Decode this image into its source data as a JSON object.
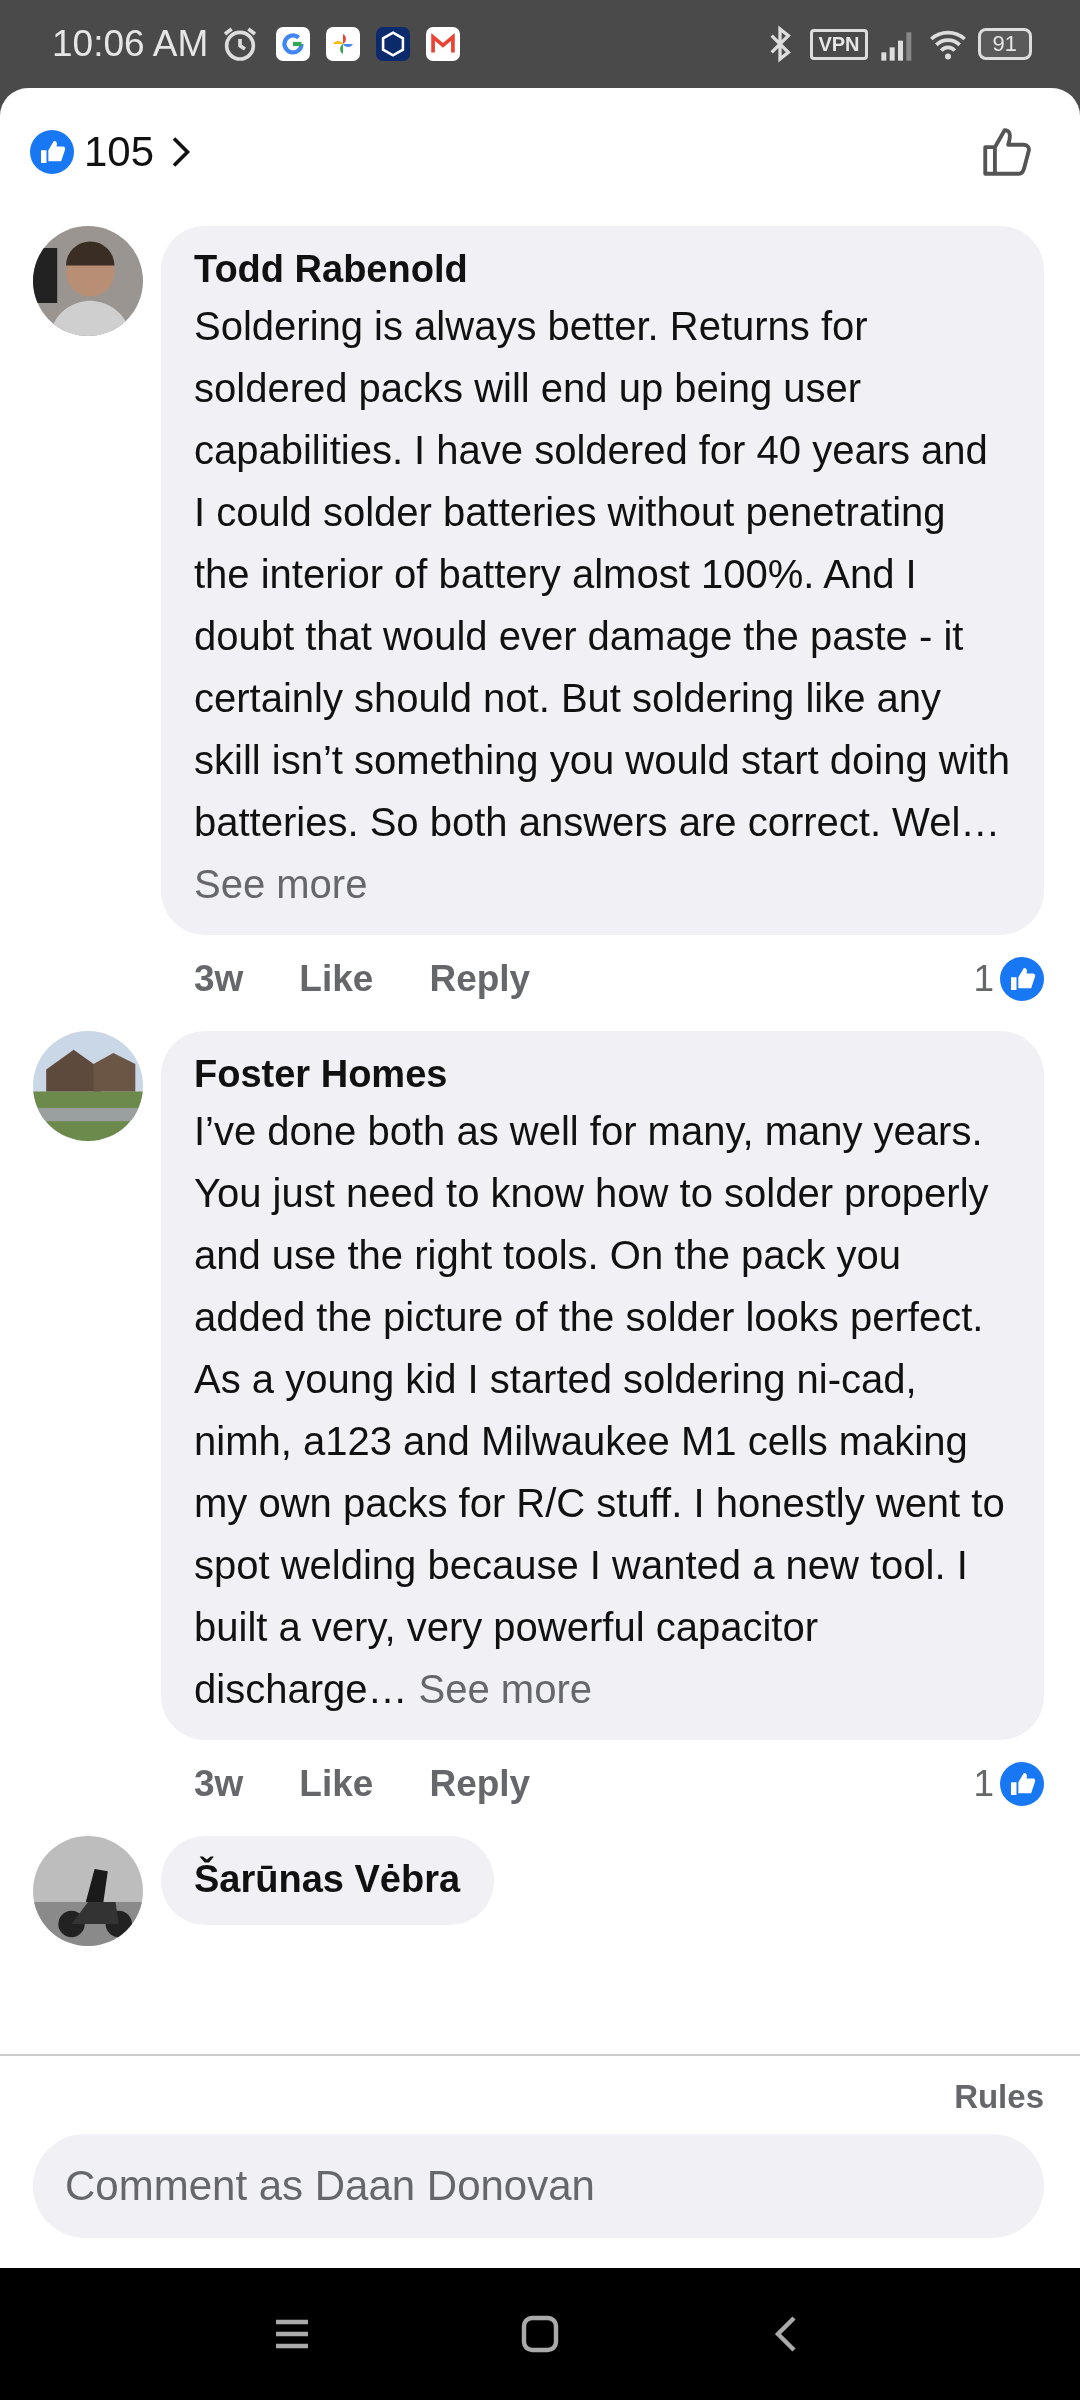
{
  "status_bar": {
    "time": "10:06 AM",
    "vpn": "VPN",
    "battery": "91"
  },
  "header": {
    "reaction_count": "105"
  },
  "comments": [
    {
      "author": "Todd Rabenold",
      "text": "Soldering is always better. Returns for soldered packs will end up being user capabilities.  I have soldered for 40 years and I could solder batteries without penetrating the interior of battery almost 100%.  And I doubt that would ever damage the paste - it certainly should not.   But soldering like any skill isn’t something you would start doing with batteries.  So both answers are correct.  Wel…",
      "more": "See more",
      "time": "3w",
      "like": "Like",
      "reply": "Reply",
      "reactions": "1"
    },
    {
      "author": "Foster Homes",
      "text": "I’ve done both as well for many, many years. You just need to know how to solder properly and use the right tools. On the pack you added the picture of the solder looks perfect. As a young kid I started soldering ni-cad, nimh, a123 and Milwaukee M1 cells making my own packs for R/C stuff. I honestly went to spot welding because I wanted a new tool. I built a very, very powerful capacitor discharge…",
      "more": "See more",
      "time": "3w",
      "like": "Like",
      "reply": "Reply",
      "reactions": "1"
    },
    {
      "author": "Šarūnas Vėbra"
    }
  ],
  "footer": {
    "rules": "Rules",
    "placeholder": "Comment as Daan Donovan"
  }
}
